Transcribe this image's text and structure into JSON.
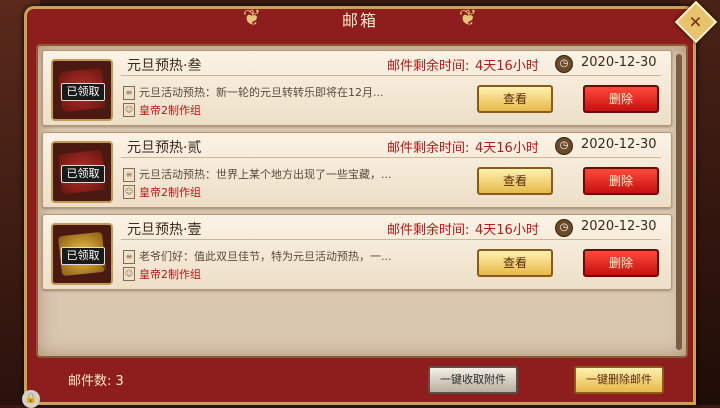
{
  "window": {
    "title": "邮箱"
  },
  "mails": [
    {
      "badge": "已领取",
      "count": "2",
      "title": "元旦预热·叁",
      "expire_label": "邮件剩余时间:",
      "expire_value": "4天16小时",
      "date": "2020-12-30",
      "preview": "元旦活动预热：新一轮的元旦转转乐即将在12月...",
      "sender": "皇帝2制作组",
      "view_label": "查看",
      "delete_label": "删除"
    },
    {
      "badge": "已领取",
      "count": "1",
      "title": "元旦预热·贰",
      "expire_label": "邮件剩余时间:",
      "expire_value": "4天16小时",
      "date": "2020-12-30",
      "preview": "元旦活动预热：世界上某个地方出现了一些宝藏，...",
      "sender": "皇帝2制作组",
      "view_label": "查看",
      "delete_label": "删除"
    },
    {
      "badge": "已领取",
      "count": "1",
      "title": "元旦预热·壹",
      "expire_label": "邮件剩余时间:",
      "expire_value": "4天16小时",
      "date": "2020-12-30",
      "preview": "老爷们好：值此双旦佳节，特为元旦活动预热，一...",
      "sender": "皇帝2制作组",
      "view_label": "查看",
      "delete_label": "删除"
    }
  ],
  "footer": {
    "mail_count_label": "邮件数:",
    "mail_count": "3",
    "claim_all_label": "一键收取附件",
    "delete_all_label": "一键删除邮件"
  }
}
